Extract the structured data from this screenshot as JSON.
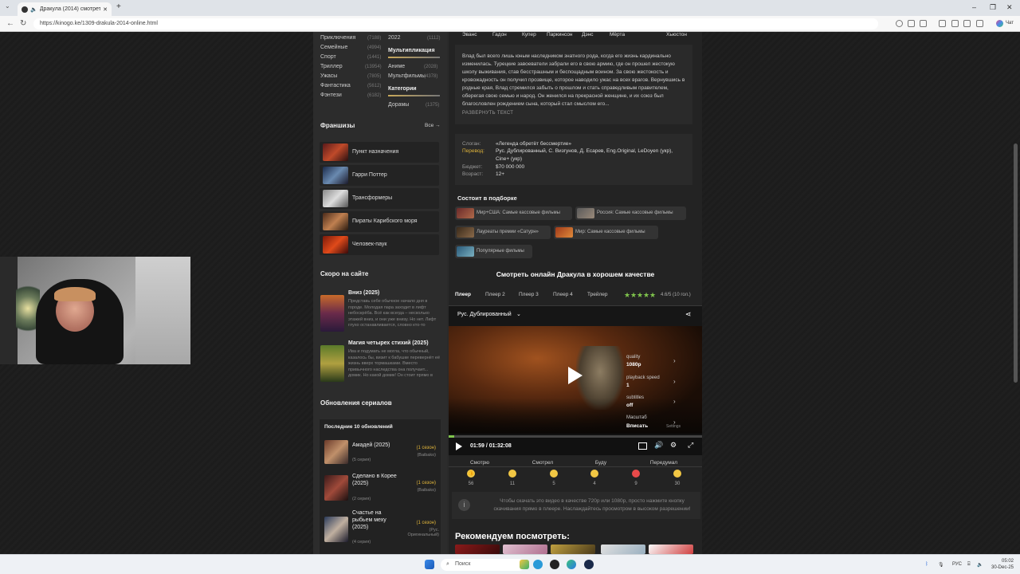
{
  "browser": {
    "tab_title": "Дракула (2014) смотреть бес",
    "url": "https://kinogo.ke/1309-drakula-2014-online.html",
    "profile_label": "Чат"
  },
  "genres": [
    {
      "name": "Приключения",
      "count": "(7188)"
    },
    {
      "name": "Семейные",
      "count": "(4994)"
    },
    {
      "name": "Спорт",
      "count": "(1441)"
    },
    {
      "name": "Триллер",
      "count": "(13954)"
    },
    {
      "name": "Ужасы",
      "count": "(7805)"
    },
    {
      "name": "Фантастика",
      "count": "(5612)"
    },
    {
      "name": "Фэнтези",
      "count": "(6182)"
    }
  ],
  "genres_right": {
    "year": {
      "name": "2022",
      "count": "(1112)"
    },
    "anim_heading": "Мультипликация",
    "anime": {
      "name": "Аниме",
      "count": "(2028)"
    },
    "cartoons": {
      "name": "Мультфильмы",
      "count": "(4378)"
    },
    "cat_heading": "Категории",
    "doramy": {
      "name": "Дорамы",
      "count": "(1375)"
    }
  },
  "franchises": {
    "title": "Франшизы",
    "all_label": "Все →",
    "items": [
      "Пункт назначения",
      "Гарри Поттер",
      "Трансформеры",
      "Пираты Карибского моря",
      "Человек-паук"
    ]
  },
  "soon": {
    "title": "Скоро на сайте",
    "items": [
      {
        "title": "Вниз (2025)",
        "desc": "Представь себе обычное начало дня в городе. Молодая пара заходит в лифт небоскрёба. Всё как всегда – несколько этажей вниз, и они уже внизу. Но нет. Лифт глухо останавливается, словно кто-то"
      },
      {
        "title": "Магия четырех стихий (2025)",
        "desc": "Ива и подумать не могла, что обычный, казалось бы, визит к бабушке перевернёт её жизнь вверх тормашками. Вместо привычного наследства она получает... домик. Но какой домик! Он стоит прямо в"
      }
    ]
  },
  "series_updates": {
    "title": "Обновления сериалов",
    "box_title": "Последние 10 обновлений",
    "items": [
      {
        "title": "Амадей (2025)",
        "episodes": "(5 серия)",
        "season": "(1 сезон)",
        "voice": "(Baibako)"
      },
      {
        "title": "Сделано в Корее (2025)",
        "episodes": "(2 серия)",
        "season": "(1 сезон)",
        "voice": "(Baibako)"
      },
      {
        "title": "Счастье на рыбьем меху (2025)",
        "episodes": "(4 серия)",
        "season": "(1 сезон)",
        "voice": "(Рус. Оригинальный)"
      }
    ]
  },
  "cast": [
    "Эванс",
    "Гадон",
    "Купер",
    "Паркинсон",
    "Дэнс",
    "Мёртa",
    "Хьюстон"
  ],
  "description": "Влад был всего лишь юным наследником знатного рода, когда его жизнь кардинально изменилась. Турецкие завоеватели забрали его в свою армию, где он прошел жестокую школу выживания, став бесстрашным и беспощадным воином. За свою жестокость и кровожадность он получил прозвище, которое наводило ужас на всех врагов. Вернувшись в родные края, Влад стремился забыть о прошлом и стать справедливым правителем, оберегая свою семью и народ. Он женился на прекрасной женщине, и их союз был благословлен рождением сына, который стал смыслом его...",
  "expand_label": "РАЗВЕРНУТЬ ТЕКСТ",
  "info": {
    "slogan_k": "Слоган:",
    "slogan_v": "«Легенда обретёт бессмертие»",
    "transl_k": "Перевод:",
    "transl_v": "Рус. Дублированный, С. Визгунов, Д. Есарев, Eng.Original, LeDoyen (укр), Cine+ (укр)",
    "budget_k": "Бюджет:",
    "budget_v": "$70 000 000",
    "age_k": "Возраст:",
    "age_v": "12+"
  },
  "collections": {
    "title": "Состоит в подборке",
    "items": [
      "Мир+США: Самые кассовые фильмы",
      "Россия: Самые кассовые фильмы",
      "Лауреаты премии «Сатурн»",
      "Мир: Самые кассовые фильмы",
      "Популярные фильмы"
    ]
  },
  "watch_title": "Смотреть онлайн Дракула в хорошем качестве",
  "player_tabs": [
    "Плеер",
    "Плеер 2",
    "Плеер 3",
    "Плеер 4",
    "Трейлер"
  ],
  "rating": {
    "text": "4.6/5 (10 гол.)",
    "stars": 5,
    "value": 4.6
  },
  "player": {
    "voice": "Рус. Дублированный",
    "settings": [
      {
        "key": "quality",
        "value": "1080p"
      },
      {
        "key": "playback speed",
        "value": "1"
      },
      {
        "key": "subtitles",
        "value": "off"
      },
      {
        "key": "Масштаб",
        "value": "Вписать"
      }
    ],
    "settings_label": "Settings",
    "time": "01:59 / 01:32:08",
    "progress": 0.0216
  },
  "reactions": {
    "labels": [
      "Смотрю",
      "Смотрел",
      "Буду",
      "Передумал"
    ],
    "counts": [
      "56",
      "11",
      "5",
      "4",
      "9",
      "30"
    ]
  },
  "download_note": "Чтобы скачать это видео в качестве 720p или 1080p, просто нажмите кнопку скачивания прямо в плеере. Наслаждайтесь просмотром в высоком разрешении!",
  "recommend_title": "Рекомендуем посмотреть:",
  "taskbar": {
    "search_placeholder": "Поиск",
    "lang": "РУС",
    "time": "05:02",
    "date": "30-Dec-25"
  }
}
